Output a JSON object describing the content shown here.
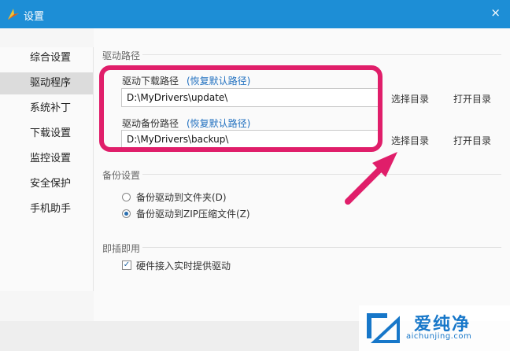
{
  "window": {
    "title": "设置",
    "close_glyph": "×"
  },
  "sidebar": {
    "items": [
      {
        "label": "综合设置",
        "active": false
      },
      {
        "label": "驱动程序",
        "active": true
      },
      {
        "label": "系统补丁",
        "active": false
      },
      {
        "label": "下载设置",
        "active": false
      },
      {
        "label": "监控设置",
        "active": false
      },
      {
        "label": "安全保护",
        "active": false
      },
      {
        "label": "手机助手",
        "active": false
      }
    ]
  },
  "driver_path": {
    "section_label": "驱动路径",
    "download": {
      "label": "驱动下载路径",
      "restore_link": "(恢复默认路径)",
      "value": "D:\\MyDrivers\\update\\",
      "select_dir": "选择目录",
      "open_dir": "打开目录"
    },
    "backup": {
      "label": "驱动备份路径",
      "restore_link": "(恢复默认路径)",
      "value": "D:\\MyDrivers\\backup\\",
      "select_dir": "选择目录",
      "open_dir": "打开目录"
    }
  },
  "backup_settings": {
    "section_label": "备份设置",
    "options": [
      {
        "label": "备份驱动到文件夹(D)",
        "checked": false
      },
      {
        "label": "备份驱动到ZIP压缩文件(Z)",
        "checked": true
      }
    ]
  },
  "plug_and_play": {
    "section_label": "即插即用",
    "checkbox_label": "硬件接入实时提供驱动",
    "checked": true
  },
  "watermark": {
    "title": "爱纯净",
    "url": "aichunjing.com"
  },
  "colors": {
    "titlebar": "#1d8ed6",
    "highlight": "#e01e6a",
    "link": "#1f6fbf"
  },
  "icons": [
    "app-logo-icon",
    "close-icon",
    "radio-icon",
    "checkbox-icon",
    "arrow-annotation-icon"
  ]
}
